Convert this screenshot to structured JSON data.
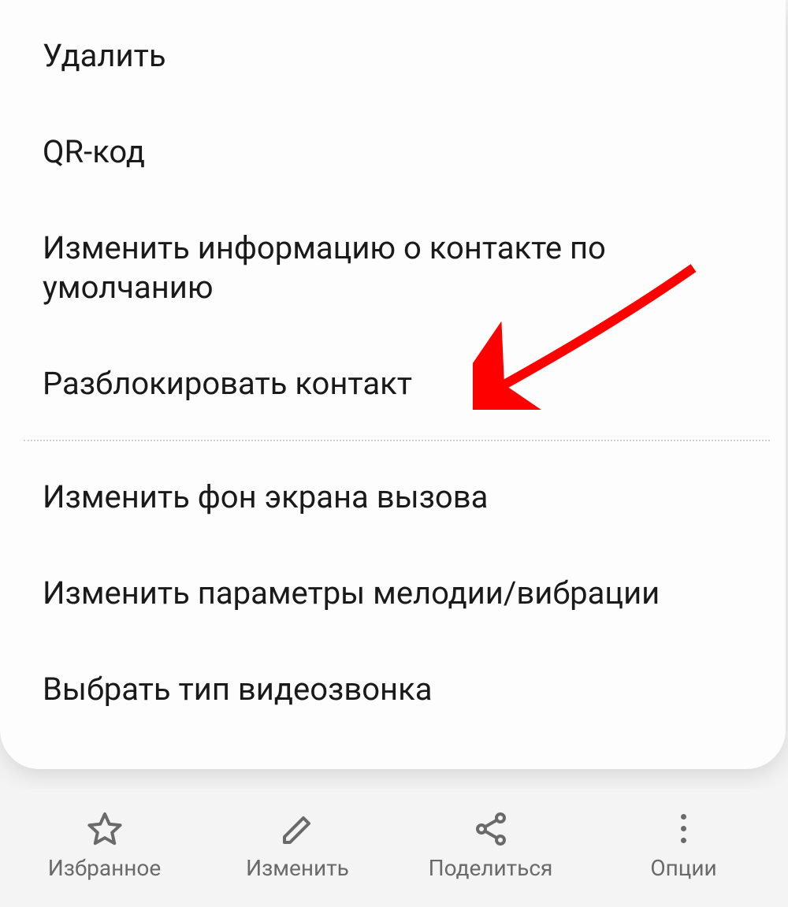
{
  "menu": {
    "items_top": [
      "Удалить",
      "QR-код",
      "Изменить информацию о контакте по умолчанию",
      "Разблокировать контакт"
    ],
    "items_bottom": [
      "Изменить фон экрана вызова",
      "Изменить параметры мелодии/вибрации",
      "Выбрать тип видеозвонка"
    ]
  },
  "bottom_bar": {
    "favorite": "Избранное",
    "edit": "Изменить",
    "share": "Поделиться",
    "options": "Опции"
  },
  "annotation": {
    "arrow_target": "Разблокировать контакт",
    "arrow_color": "#ff0000"
  }
}
